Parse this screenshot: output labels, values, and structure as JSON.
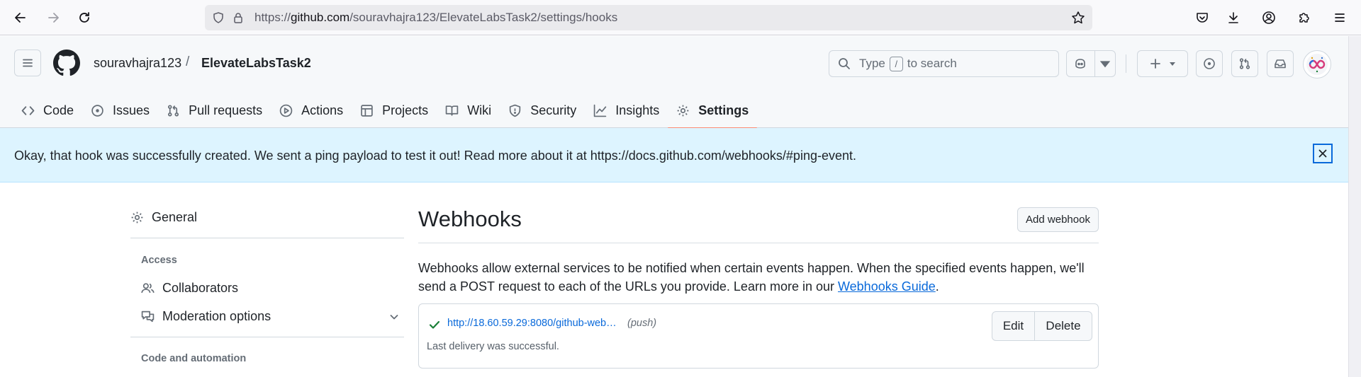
{
  "browser": {
    "url_prefix": "https://",
    "url_host": "github.com",
    "url_path": "/souravhajra123/ElevateLabsTask2/settings/hooks"
  },
  "header": {
    "owner": "souravhajra123",
    "separator": "/",
    "repo": "ElevateLabsTask2",
    "search_prefix": "Type",
    "search_key": "/",
    "search_suffix": "to search"
  },
  "tabs": [
    {
      "label": "Code",
      "icon": "code-icon"
    },
    {
      "label": "Issues",
      "icon": "issue-icon"
    },
    {
      "label": "Pull requests",
      "icon": "pull-request-icon"
    },
    {
      "label": "Actions",
      "icon": "play-icon"
    },
    {
      "label": "Projects",
      "icon": "table-icon"
    },
    {
      "label": "Wiki",
      "icon": "book-icon"
    },
    {
      "label": "Security",
      "icon": "shield-icon"
    },
    {
      "label": "Insights",
      "icon": "graph-icon"
    },
    {
      "label": "Settings",
      "icon": "gear-icon",
      "active": true
    }
  ],
  "flash": {
    "message": "Okay, that hook was successfully created. We sent a ping payload to test it out! Read more about it at https://docs.github.com/webhooks/#ping-event."
  },
  "sidebar": {
    "general": "General",
    "access_heading": "Access",
    "collaborators": "Collaborators",
    "moderation": "Moderation options",
    "code_heading": "Code and automation"
  },
  "main": {
    "title": "Webhooks",
    "add_button": "Add webhook",
    "desc_text": "Webhooks allow external services to be notified when certain events happen. When the specified events happen, we'll send a POST request to each of the URLs you provide. Learn more in our ",
    "desc_link": "Webhooks Guide",
    "desc_end": ".",
    "hook": {
      "url": "http://18.60.59.29:8080/github-web…",
      "events": "(push)",
      "status": "Last delivery was successful.",
      "edit_label": "Edit",
      "delete_label": "Delete"
    }
  },
  "colors": {
    "accent": "#0969da",
    "success": "#1a7f37",
    "flash_bg": "#ddf4ff",
    "tab_underline": "#fd8c73"
  }
}
